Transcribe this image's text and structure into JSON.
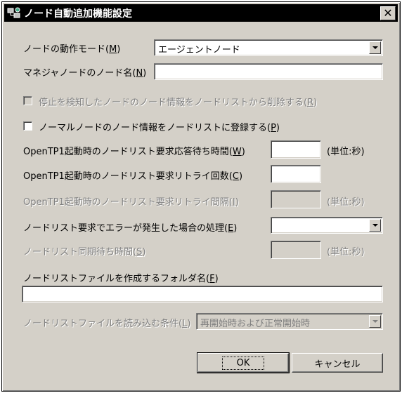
{
  "window": {
    "title": "ノード自動追加機能設定",
    "close_label": "✕"
  },
  "form": {
    "mode_label": "ノードの動作モード(",
    "mode_mnemonic": "M",
    "mode_value": "エージェントノード",
    "manager_name_label": "マネジャノードのノード名(",
    "manager_name_mnemonic": "N",
    "manager_name_value": "",
    "delete_stopped_label": "停止を検知したノードのノード情報をノードリストから削除する(",
    "delete_stopped_mnemonic": "R",
    "delete_stopped_checked": false,
    "register_normal_label": "ノーマルノードのノード情報をノードリストに登録する(",
    "register_normal_mnemonic": "P",
    "register_normal_checked": false,
    "wait_time_label": "OpenTP1起動時のノードリスト要求応答待ち時間(",
    "wait_time_mnemonic": "W",
    "wait_time_value": "",
    "wait_time_unit": "(単位:秒)",
    "retry_count_label": "OpenTP1起動時のノードリスト要求リトライ回数(",
    "retry_count_mnemonic": "C",
    "retry_count_value": "",
    "retry_interval_label": "OpenTP1起動時のノードリスト要求リトライ間隔(",
    "retry_interval_mnemonic": "I",
    "retry_interval_value": "",
    "retry_interval_unit": "(単位:秒)",
    "error_handling_label": "ノードリスト要求でエラーが発生した場合の処理(",
    "error_handling_mnemonic": "E",
    "error_handling_value": "",
    "sync_wait_label": "ノードリスト同期待ち時間(",
    "sync_wait_mnemonic": "S",
    "sync_wait_value": "",
    "sync_wait_unit": "(単位:秒)",
    "folder_label": "ノードリストファイルを作成するフォルダ名(",
    "folder_mnemonic": "F",
    "folder_value": "",
    "load_condition_label": "ノードリストファイルを読み込む条件(",
    "load_condition_mnemonic": "L",
    "load_condition_value": "再開始時および正常開始時",
    "close_paren": ")"
  },
  "buttons": {
    "ok_label": "OK",
    "cancel_label": "キャンセル"
  }
}
